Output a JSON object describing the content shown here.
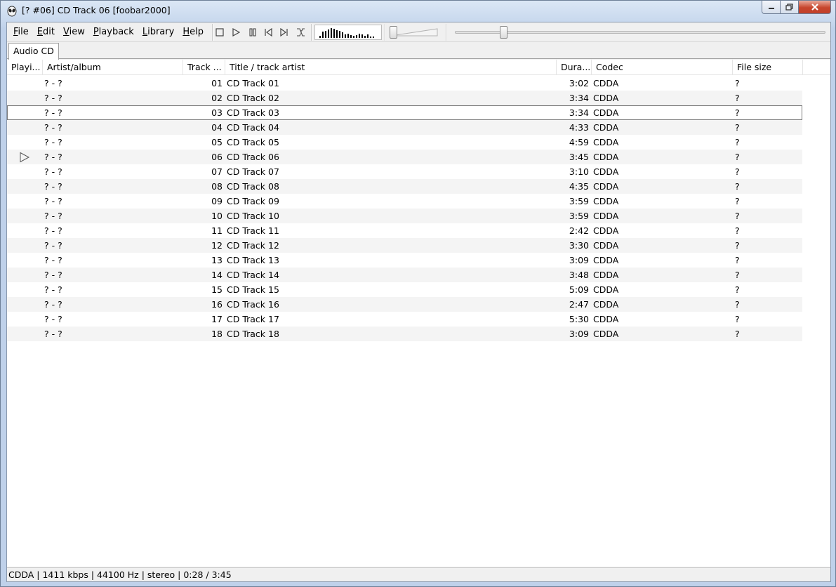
{
  "window": {
    "title": "[? #06] CD Track 06  [foobar2000]"
  },
  "menu": [
    {
      "key": "F",
      "rest": "ile"
    },
    {
      "key": "E",
      "rest": "dit"
    },
    {
      "key": "V",
      "rest": "iew"
    },
    {
      "key": "P",
      "rest": "layback"
    },
    {
      "key": "L",
      "rest": "ibrary"
    },
    {
      "key": "H",
      "rest": "elp"
    }
  ],
  "visualization_levels": [
    0.2,
    0.55,
    0.6,
    0.75,
    0.85,
    0.8,
    0.7,
    0.6,
    0.5,
    0.3,
    0.35,
    0.25,
    0.2,
    0.25,
    0.4,
    0.3,
    0.2,
    0.3,
    0.15,
    0.1
  ],
  "playback": {
    "volume_fraction": 0.0,
    "seek_fraction": 0.124
  },
  "tabs": [
    {
      "label": "Audio CD"
    }
  ],
  "columns": [
    {
      "label": "Playi..."
    },
    {
      "label": "Artist/album"
    },
    {
      "label": "Track ..."
    },
    {
      "label": "Title / track artist"
    },
    {
      "label": "Dura..."
    },
    {
      "label": "Codec"
    },
    {
      "label": "File size"
    }
  ],
  "tracks": [
    {
      "artist": "? - ?",
      "track": "01",
      "title": "CD Track 01",
      "duration": "3:02",
      "codec": "CDDA",
      "size": "?"
    },
    {
      "artist": "? - ?",
      "track": "02",
      "title": "CD Track 02",
      "duration": "3:34",
      "codec": "CDDA",
      "size": "?"
    },
    {
      "artist": "? - ?",
      "track": "03",
      "title": "CD Track 03",
      "duration": "3:34",
      "codec": "CDDA",
      "size": "?"
    },
    {
      "artist": "? - ?",
      "track": "04",
      "title": "CD Track 04",
      "duration": "4:33",
      "codec": "CDDA",
      "size": "?"
    },
    {
      "artist": "? - ?",
      "track": "05",
      "title": "CD Track 05",
      "duration": "4:59",
      "codec": "CDDA",
      "size": "?"
    },
    {
      "artist": "? - ?",
      "track": "06",
      "title": "CD Track 06",
      "duration": "3:45",
      "codec": "CDDA",
      "size": "?"
    },
    {
      "artist": "? - ?",
      "track": "07",
      "title": "CD Track 07",
      "duration": "3:10",
      "codec": "CDDA",
      "size": "?"
    },
    {
      "artist": "? - ?",
      "track": "08",
      "title": "CD Track 08",
      "duration": "4:35",
      "codec": "CDDA",
      "size": "?"
    },
    {
      "artist": "? - ?",
      "track": "09",
      "title": "CD Track 09",
      "duration": "3:59",
      "codec": "CDDA",
      "size": "?"
    },
    {
      "artist": "? - ?",
      "track": "10",
      "title": "CD Track 10",
      "duration": "3:59",
      "codec": "CDDA",
      "size": "?"
    },
    {
      "artist": "? - ?",
      "track": "11",
      "title": "CD Track 11",
      "duration": "2:42",
      "codec": "CDDA",
      "size": "?"
    },
    {
      "artist": "? - ?",
      "track": "12",
      "title": "CD Track 12",
      "duration": "3:30",
      "codec": "CDDA",
      "size": "?"
    },
    {
      "artist": "? - ?",
      "track": "13",
      "title": "CD Track 13",
      "duration": "3:09",
      "codec": "CDDA",
      "size": "?"
    },
    {
      "artist": "? - ?",
      "track": "14",
      "title": "CD Track 14",
      "duration": "3:48",
      "codec": "CDDA",
      "size": "?"
    },
    {
      "artist": "? - ?",
      "track": "15",
      "title": "CD Track 15",
      "duration": "5:09",
      "codec": "CDDA",
      "size": "?"
    },
    {
      "artist": "? - ?",
      "track": "16",
      "title": "CD Track 16",
      "duration": "2:47",
      "codec": "CDDA",
      "size": "?"
    },
    {
      "artist": "? - ?",
      "track": "17",
      "title": "CD Track 17",
      "duration": "5:30",
      "codec": "CDDA",
      "size": "?"
    },
    {
      "artist": "? - ?",
      "track": "18",
      "title": "CD Track 18",
      "duration": "3:09",
      "codec": "CDDA",
      "size": "?"
    }
  ],
  "playing_track_index": 5,
  "focused_track_index": 2,
  "status": {
    "text": "CDDA | 1411 kbps | 44100 Hz | stereo | 0:28 / 3:45"
  }
}
